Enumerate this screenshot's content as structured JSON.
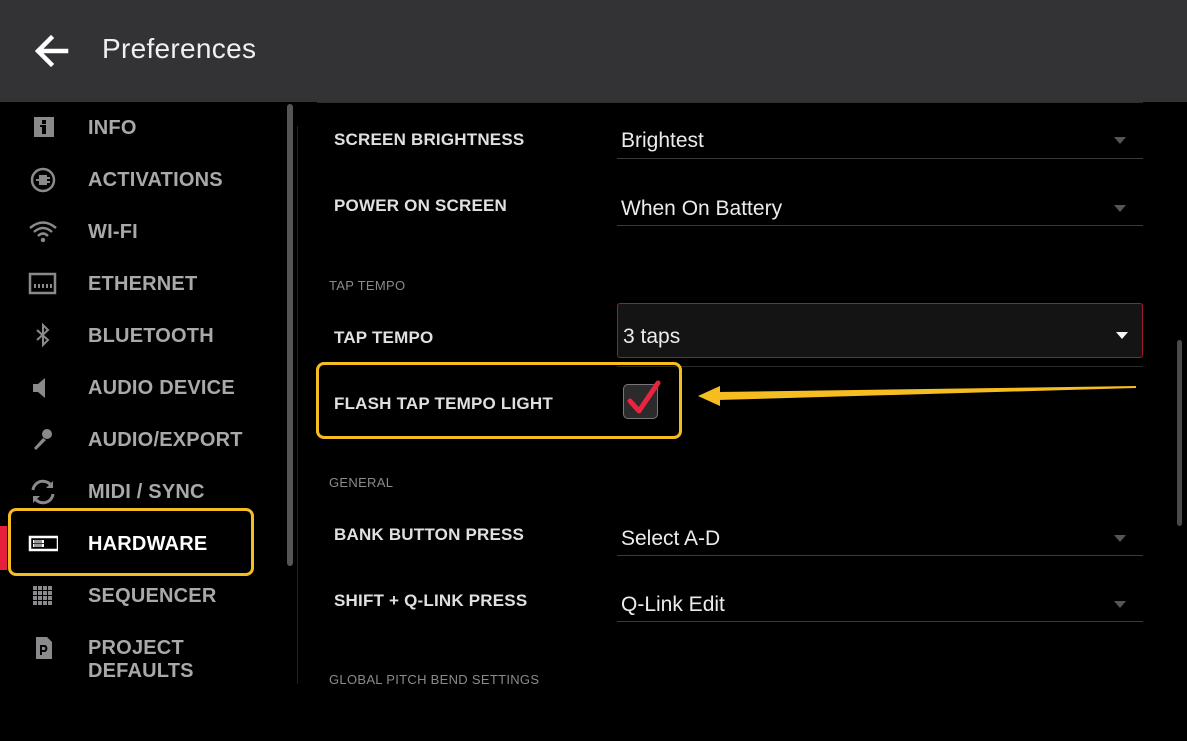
{
  "header": {
    "title": "Preferences",
    "back_icon": "arrow-left-icon"
  },
  "sidebar": {
    "items": [
      {
        "label": "INFO",
        "icon": "info-icon"
      },
      {
        "label": "ACTIVATIONS",
        "icon": "activation-plug-icon"
      },
      {
        "label": "WI-FI",
        "icon": "wifi-icon"
      },
      {
        "label": "ETHERNET",
        "icon": "ethernet-port-icon"
      },
      {
        "label": "BLUETOOTH",
        "icon": "bluetooth-icon"
      },
      {
        "label": "AUDIO DEVICE",
        "icon": "speaker-icon"
      },
      {
        "label": "AUDIO/EXPORT",
        "icon": "microphone-icon"
      },
      {
        "label": "MIDI / SYNC",
        "icon": "sync-icon"
      },
      {
        "label": "HARDWARE",
        "icon": "hardware-icon",
        "active": true
      },
      {
        "label": "SEQUENCER",
        "icon": "grid-icon"
      },
      {
        "label": "PROJECT DEFAULTS",
        "icon": "project-file-icon"
      }
    ]
  },
  "settings": {
    "screen_brightness": {
      "label": "SCREEN BRIGHTNESS",
      "value": "Brightest"
    },
    "power_on_screen": {
      "label": "POWER ON SCREEN",
      "value": "When On Battery"
    },
    "tap_tempo_section": "TAP TEMPO",
    "tap_tempo": {
      "label": "TAP TEMPO",
      "value": "3 taps"
    },
    "flash_tap_tempo_light": {
      "label": "FLASH TAP TEMPO LIGHT",
      "checked": true
    },
    "general_section": "GENERAL",
    "bank_button_press": {
      "label": "BANK BUTTON PRESS",
      "value": "Select A-D"
    },
    "shift_qlink_press": {
      "label": "SHIFT + Q-LINK PRESS",
      "value": "Q-Link Edit"
    },
    "global_pitch_bend_section": "GLOBAL PITCH BEND SETTINGS"
  },
  "colors": {
    "accent_red": "#e5203b",
    "highlight_yellow": "#f5bd1f",
    "checkmark_red": "#e8243f",
    "header_bg": "#333336"
  }
}
